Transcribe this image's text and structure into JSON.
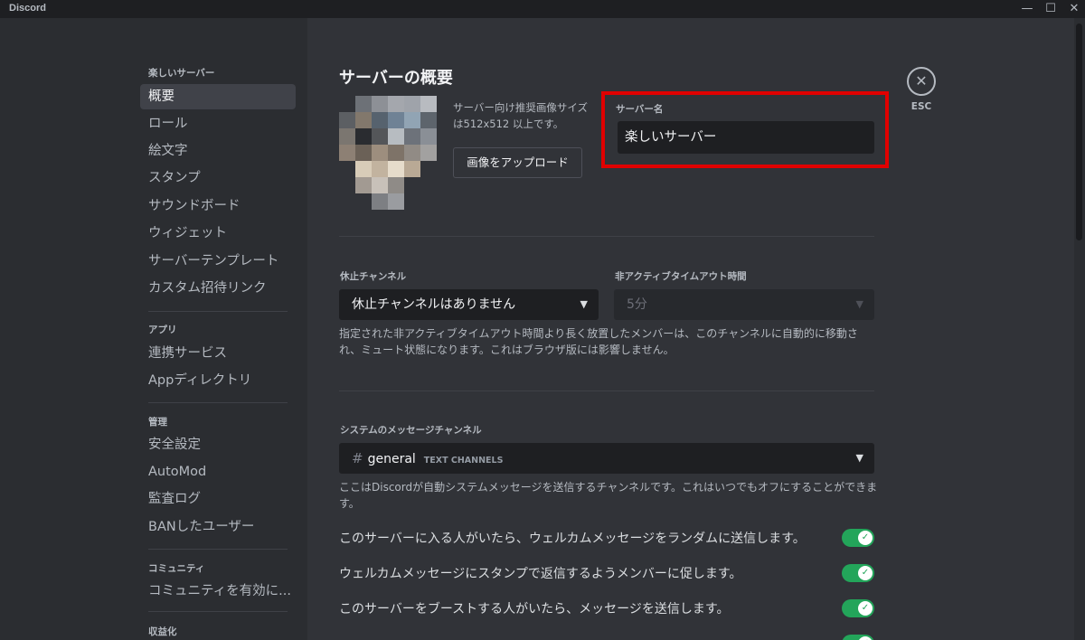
{
  "window": {
    "title": "Discord",
    "minimize": "—",
    "maximize": "☐",
    "close": "✕"
  },
  "sidebar": {
    "sections": [
      "楽しいサーバー",
      "アプリ",
      "管理",
      "コミュニティ",
      "収益化"
    ],
    "items": [
      "概要",
      "ロール",
      "絵文字",
      "スタンプ",
      "サウンドボード",
      "ウィジェット",
      "サーバーテンプレート",
      "カスタム招待リンク",
      "連携サービス",
      "Appディレクトリ",
      "安全設定",
      "AutoMod",
      "監査ログ",
      "BANしたユーザー",
      "コミュニティを有効に..."
    ]
  },
  "main": {
    "page_title": "サーバーの概要",
    "upload_hint": "サーバー向け推奨画像サイズは512x512 以上です。",
    "upload_button": "画像をアップロード",
    "server_name_label": "サーバー名",
    "server_name_value": "楽しいサーバー",
    "afk_channel_label": "休止チャンネル",
    "afk_channel_value": "休止チャンネルはありません",
    "afk_timeout_label": "非アクティブタイムアウト時間",
    "afk_timeout_value": "5分",
    "afk_help": "指定された非アクティブタイムアウト時間より長く放置したメンバーは、このチャンネルに自動的に移動され、ミュート状態になります。これはブラウザ版には影響しません。",
    "system_channel_label": "システムのメッセージチャンネル",
    "system_channel_name": "general",
    "system_channel_category": "TEXT CHANNELS",
    "system_help": "ここはDiscordが自動システムメッセージを送信するチャンネルです。これはいつでもオフにすることができます。",
    "toggles": [
      {
        "label": "このサーバーに入る人がいたら、ウェルカムメッセージをランダムに送信します。",
        "checked": true
      },
      {
        "label": "ウェルカムメッセージにスタンプで返信するようメンバーに促します。",
        "checked": true
      },
      {
        "label": "このサーバーをブーストする人がいたら、メッセージを送信します。",
        "checked": true
      }
    ],
    "esc_label": "ESC"
  },
  "colors": {
    "sidebar_bg": "#2b2d31",
    "content_bg": "#313338",
    "input_bg": "#1e1f22",
    "toggle_on": "#23a55a",
    "highlight": "#e00000"
  }
}
